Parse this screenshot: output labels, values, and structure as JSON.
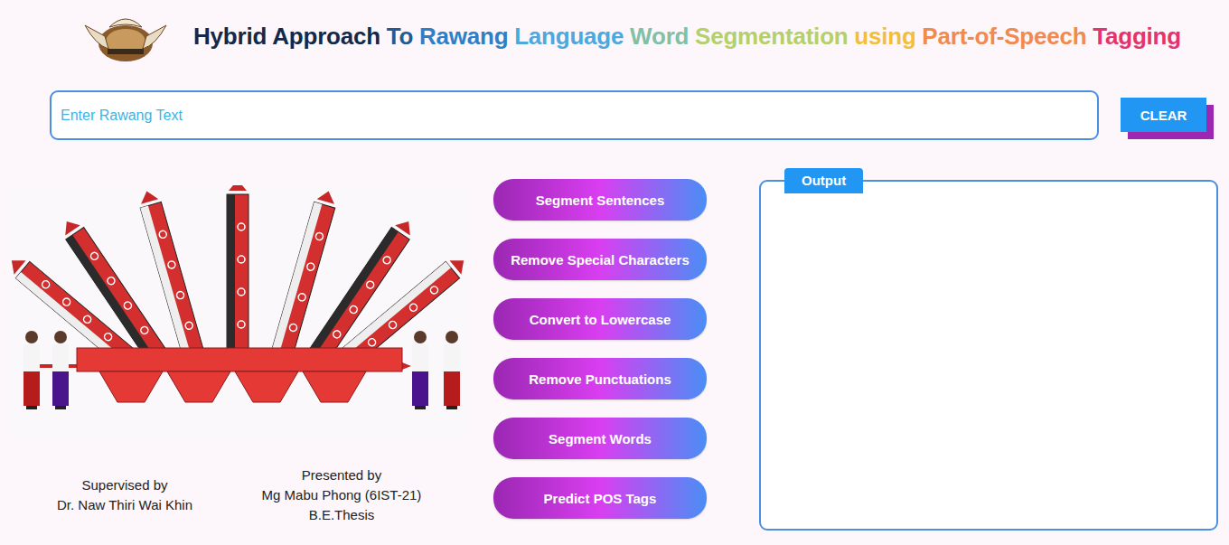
{
  "header": {
    "title_words": [
      {
        "text": "Hybrid Approach",
        "color": "#12294a"
      },
      {
        "text": "To",
        "color": "#1f5c96"
      },
      {
        "text": "Rawang",
        "color": "#2e80c6"
      },
      {
        "text": "Language",
        "color": "#4ea7dd"
      },
      {
        "text": "Word",
        "color": "#7fc0a6"
      },
      {
        "text": "Segmentation",
        "color": "#b4d06a"
      },
      {
        "text": "using",
        "color": "#f3be3c"
      },
      {
        "text": "Part-of-Speech",
        "color": "#f08a4e"
      },
      {
        "text": "Tagging",
        "color": "#e5336c"
      }
    ]
  },
  "input": {
    "placeholder": "Enter Rawang Text"
  },
  "clear_button": "CLEAR",
  "actions": [
    "Segment Sentences",
    "Remove Special Characters",
    "Convert to Lowercase",
    "Remove Punctuations",
    "Segment Words",
    "Predict POS Tags"
  ],
  "output": {
    "label": "Output"
  },
  "credits": {
    "supervised_label": "Supervised by",
    "supervisor": "Dr. Naw Thiri Wai Khin",
    "presented_label": "Presented by",
    "presenter": "Mg Mabu Phong (6IST-21)",
    "degree": "B.E.Thesis"
  }
}
